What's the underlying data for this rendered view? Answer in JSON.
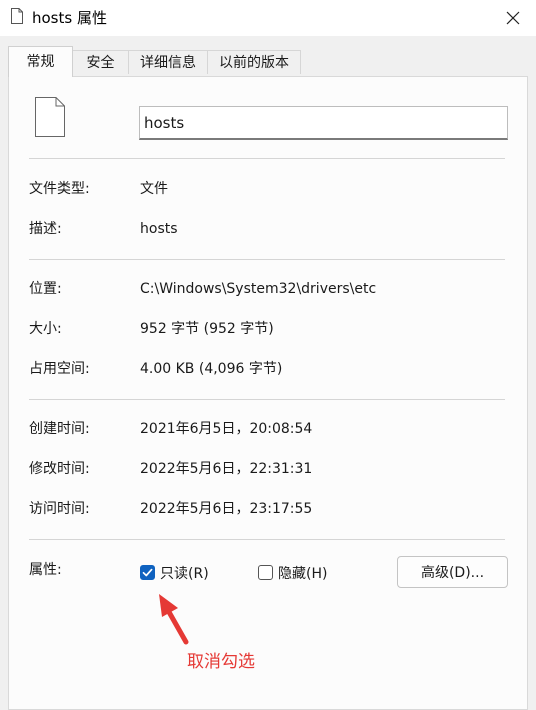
{
  "window": {
    "title": "hosts 属性",
    "close_icon": "close-icon"
  },
  "tabs": [
    {
      "label": "常规",
      "active": true
    },
    {
      "label": "安全",
      "active": false
    },
    {
      "label": "详细信息",
      "active": false
    },
    {
      "label": "以前的版本",
      "active": false
    }
  ],
  "general": {
    "file_name": "hosts",
    "file_type_label": "文件类型:",
    "file_type_value": "文件",
    "description_label": "描述:",
    "description_value": "hosts",
    "location_label": "位置:",
    "location_value": "C:\\Windows\\System32\\drivers\\etc",
    "size_label": "大小:",
    "size_value": "952 字节 (952 字节)",
    "size_on_disk_label": "占用空间:",
    "size_on_disk_value": "4.00 KB (4,096 字节)",
    "created_label": "创建时间:",
    "created_value": "2021年6月5日，20:08:54",
    "modified_label": "修改时间:",
    "modified_value": "2022年5月6日，22:31:31",
    "accessed_label": "访问时间:",
    "accessed_value": "2022年5月6日，23:17:55",
    "attributes_label": "属性:",
    "readonly_label": "只读(R)",
    "readonly_checked": true,
    "hidden_label": "隐藏(H)",
    "hidden_checked": false,
    "advanced_button": "高级(D)..."
  },
  "annotation": {
    "text": "取消勾选",
    "color": "#e53935"
  },
  "colors": {
    "checkbox_accent": "#0f62c0",
    "annotation": "#e53935"
  }
}
